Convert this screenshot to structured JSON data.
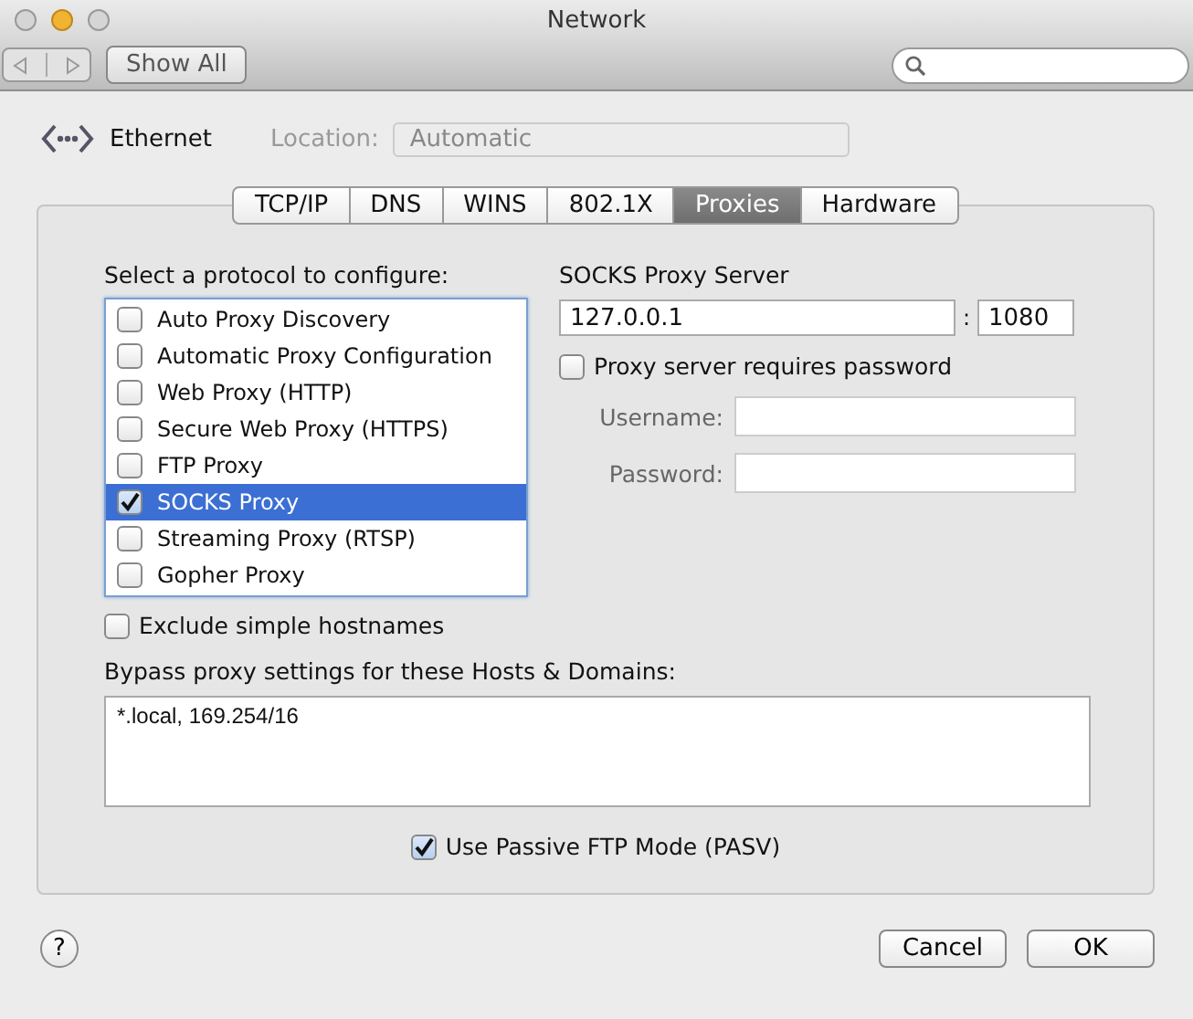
{
  "window": {
    "title": "Network"
  },
  "toolbar": {
    "show_all": "Show All"
  },
  "header": {
    "service": "Ethernet",
    "location_label": "Location:",
    "location_value": "Automatic"
  },
  "tabs": [
    {
      "label": "TCP/IP",
      "selected": false
    },
    {
      "label": "DNS",
      "selected": false
    },
    {
      "label": "WINS",
      "selected": false
    },
    {
      "label": "802.1X",
      "selected": false
    },
    {
      "label": "Proxies",
      "selected": true
    },
    {
      "label": "Hardware",
      "selected": false
    }
  ],
  "protocols": {
    "label": "Select a protocol to configure:",
    "items": [
      {
        "label": "Auto Proxy Discovery",
        "checked": false,
        "selected": false
      },
      {
        "label": "Automatic Proxy Configuration",
        "checked": false,
        "selected": false
      },
      {
        "label": "Web Proxy (HTTP)",
        "checked": false,
        "selected": false
      },
      {
        "label": "Secure Web Proxy (HTTPS)",
        "checked": false,
        "selected": false
      },
      {
        "label": "FTP Proxy",
        "checked": false,
        "selected": false
      },
      {
        "label": "SOCKS Proxy",
        "checked": true,
        "selected": true
      },
      {
        "label": "Streaming Proxy (RTSP)",
        "checked": false,
        "selected": false
      },
      {
        "label": "Gopher Proxy",
        "checked": false,
        "selected": false
      }
    ]
  },
  "server": {
    "label": "SOCKS Proxy Server",
    "host": "127.0.0.1",
    "separator": ":",
    "port": "1080",
    "requires_password": {
      "label": "Proxy server requires password",
      "checked": false
    },
    "username": {
      "label": "Username:"
    },
    "password": {
      "label": "Password:"
    }
  },
  "exclude_simple_hostnames": {
    "label": "Exclude simple hostnames",
    "checked": false
  },
  "bypass": {
    "label": "Bypass proxy settings for these Hosts & Domains:",
    "value": "*.local, 169.254/16"
  },
  "passive_ftp": {
    "label": "Use Passive FTP Mode (PASV)",
    "checked": true
  },
  "help": "?",
  "buttons": [
    {
      "label": "Cancel"
    },
    {
      "label": "OK"
    }
  ]
}
